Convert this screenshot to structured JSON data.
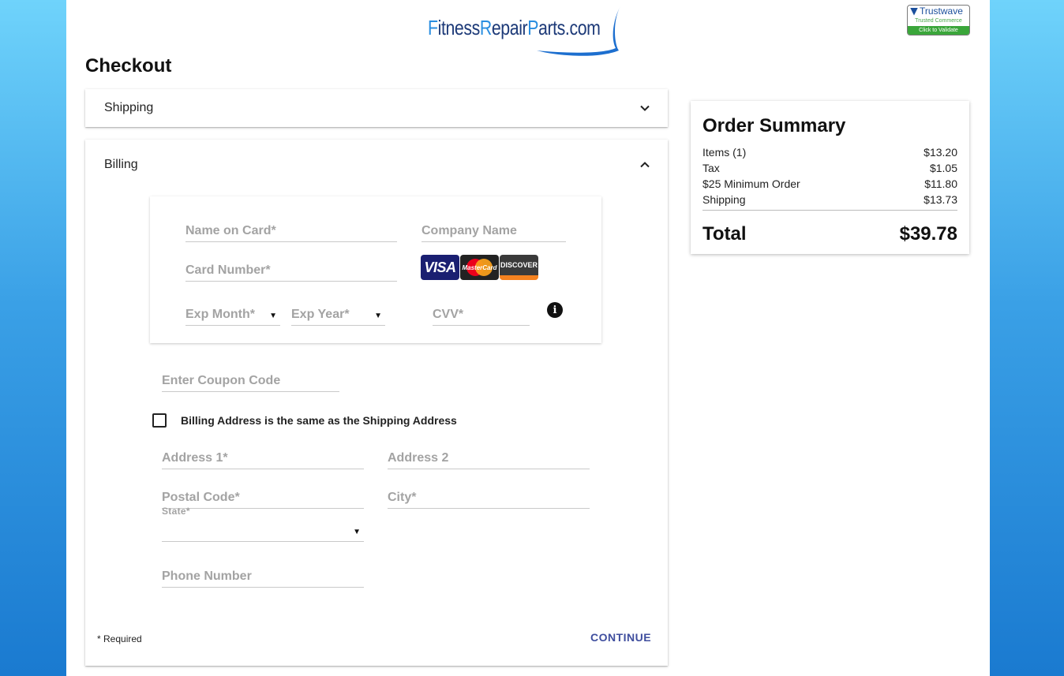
{
  "brand": {
    "logo_part1_cap": "F",
    "logo_part1_rest": "itness",
    "logo_part2_cap": "R",
    "logo_part2_rest": "epair",
    "logo_part3_cap": "P",
    "logo_part3_rest": "arts.com",
    "trust_title": "Trustwave",
    "trust_sub": "Trusted Commerce",
    "trust_cta": "Click to Validate"
  },
  "page_title": "Checkout",
  "shipping": {
    "label": "Shipping"
  },
  "billing": {
    "label": "Billing",
    "name_on_card": "Name on Card*",
    "company_name": "Company Name",
    "card_number": "Card Number*",
    "exp_month": "Exp Month*",
    "exp_year": "Exp Year*",
    "cvv": "CVV*",
    "cards": {
      "visa": "VISA",
      "mastercard": "MasterCard",
      "discover": "DISCOVER"
    },
    "coupon": "Enter Coupon Code",
    "same_address": "Billing Address is the same as the Shipping Address",
    "address1": "Address 1*",
    "address2": "Address 2",
    "postal_code": "Postal Code*",
    "city": "City*",
    "state": "State*",
    "phone": "Phone Number",
    "required_note": "* Required",
    "continue": "CONTINUE"
  },
  "summary": {
    "title": "Order Summary",
    "rows": [
      {
        "label": "Items (1)",
        "value": "$13.20"
      },
      {
        "label": "Tax",
        "value": "$1.05"
      },
      {
        "label": "$25 Minimum Order",
        "value": "$11.80"
      },
      {
        "label": "Shipping",
        "value": "$13.73"
      }
    ],
    "total_label": "Total",
    "total_value": "$39.78"
  },
  "icons": {
    "chevron_down": "chevron-down-icon",
    "chevron_up": "chevron-up-icon",
    "info": "info-icon",
    "select_arrow": "▼"
  },
  "colors": {
    "accent": "#3f4e9e",
    "logo_dark": "#1d3a78",
    "logo_light": "#2a8ee0",
    "bg_gradient_top": "#6fd3fb",
    "bg_gradient_bottom": "#1a7ad0"
  }
}
